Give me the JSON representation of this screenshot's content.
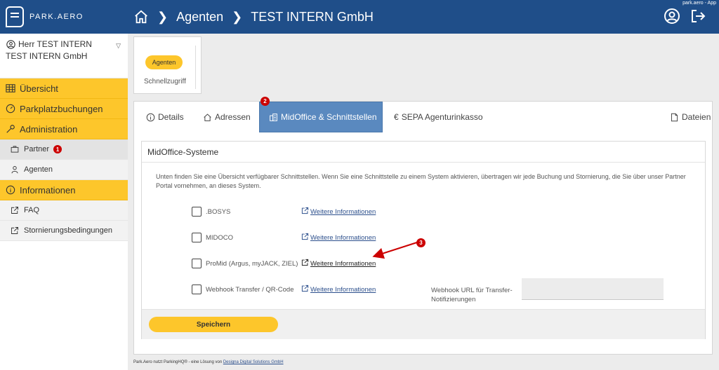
{
  "app": {
    "logo_text": "PARK.AERO",
    "top_right": "park.aero - App"
  },
  "breadcrumb": {
    "items": [
      "Agenten",
      "TEST INTERN GmbH"
    ]
  },
  "user": {
    "name": "Herr TEST INTERN",
    "company": "TEST INTERN GmbH"
  },
  "sidebar": {
    "items": [
      {
        "label": "Übersicht",
        "type": "section"
      },
      {
        "label": "Parkplatzbuchungen",
        "type": "section"
      },
      {
        "label": "Administration",
        "type": "section"
      },
      {
        "label": "Partner",
        "type": "sub",
        "badge": "1"
      },
      {
        "label": "Agenten",
        "type": "sub"
      },
      {
        "label": "Informationen",
        "type": "section"
      },
      {
        "label": "FAQ",
        "type": "sub"
      },
      {
        "label": "Stornierungsbedingungen",
        "type": "sub"
      }
    ]
  },
  "quick_access": {
    "pill": "Agenten",
    "label": "Schnellzugriff"
  },
  "tabs": {
    "details": "Details",
    "addresses": "Adressen",
    "midoffice": "MidOffice & Schnittstellen",
    "midoffice_badge": "2",
    "sepa": "SEPA Agenturinkasso",
    "files": "Dateien"
  },
  "panel": {
    "title": "MidOffice-Systeme",
    "description": "Unten finden Sie eine Übersicht verfügbarer Schnittstellen. Wenn Sie eine Schnittstelle zu einem System aktivieren, übertragen wir jede Buchung und Stornierung, die Sie über unser Partner Portal vornehmen, an dieses System.",
    "systems": [
      {
        "name": ".BOSYS",
        "link": "Weitere Informationen"
      },
      {
        "name": "MIDOCO",
        "link": "Weitere Informationen"
      },
      {
        "name": "ProMid (Argus, myJACK, ZIEL)",
        "link": "Weitere Informationen"
      },
      {
        "name": "Webhook Transfer / QR-Code",
        "link": "Weitere Informationen"
      }
    ],
    "webhook_label": "Webhook URL für Transfer-Notifizierungen",
    "webhook_value": "",
    "save_label": "Speichern",
    "annotation_badge": "3"
  },
  "footer": {
    "prefix": "Park.Aero nutzt ParkingHQ® - eine Lösung von ",
    "link": "Designa Digital Solutions GmbH"
  },
  "colors": {
    "primary": "#1f4e89",
    "accent": "#fdc62b",
    "tab_active": "#5a89bf",
    "badge": "#cc0000"
  }
}
